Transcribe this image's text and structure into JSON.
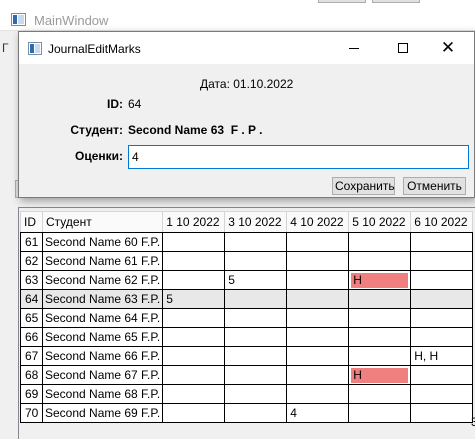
{
  "main_window": {
    "title": "MainWindow",
    "side_letter": "Г"
  },
  "dialog": {
    "title": "JournalEditMarks",
    "date_label": "Дата:",
    "date_value": "01.10.2022",
    "id_label": "ID:",
    "id_value": "64",
    "student_label": "Студент:",
    "student_value": "Second Name 63  F . P .",
    "marks_label": "Оценки:",
    "marks_value": "4",
    "save_label": "Сохранить",
    "cancel_label": "Отменить",
    "minimize_icon": "minimize-icon",
    "maximize_icon": "maximize-icon",
    "close_icon": "close-icon"
  },
  "grid": {
    "columns": [
      "ID",
      "Студент",
      "1 10 2022",
      "3 10 2022",
      "4 10 2022",
      "5 10 2022",
      "6 10 2022"
    ],
    "rows": [
      {
        "id": "61",
        "student": "Second Name 60 F.P.",
        "marks": [
          "",
          "",
          "",
          "",
          ""
        ]
      },
      {
        "id": "62",
        "student": "Second Name 61 F.P.",
        "marks": [
          "",
          "",
          "",
          "",
          ""
        ]
      },
      {
        "id": "63",
        "student": "Second Name 62 F.P.",
        "marks": [
          "",
          "5",
          "",
          "Н",
          ""
        ]
      },
      {
        "id": "64",
        "student": "Second Name 63 F.P.",
        "marks": [
          "5",
          "",
          "",
          "",
          ""
        ]
      },
      {
        "id": "65",
        "student": "Second Name 64 F.P.",
        "marks": [
          "",
          "",
          "",
          "",
          ""
        ]
      },
      {
        "id": "66",
        "student": "Second Name 65 F.P.",
        "marks": [
          "",
          "",
          "",
          "",
          ""
        ]
      },
      {
        "id": "67",
        "student": "Second Name 66 F.P.",
        "marks": [
          "",
          "",
          "",
          "",
          "Н, Н"
        ]
      },
      {
        "id": "68",
        "student": "Second Name 67 F.P.",
        "marks": [
          "",
          "",
          "",
          "Н",
          ""
        ]
      },
      {
        "id": "69",
        "student": "Second Name 68 F.P.",
        "marks": [
          "",
          "",
          "",
          "",
          ""
        ]
      },
      {
        "id": "70",
        "student": "Second Name 69 F.P.",
        "marks": [
          "",
          "",
          "4",
          "",
          ""
        ]
      }
    ],
    "selected_row_id": "64",
    "highlight_color": "#f08080",
    "highlighted_cells": [
      {
        "row_id": "63",
        "column": "5 10 2022"
      },
      {
        "row_id": "68",
        "column": "5 10 2022"
      }
    ],
    "partial_last_column_value": "3"
  }
}
